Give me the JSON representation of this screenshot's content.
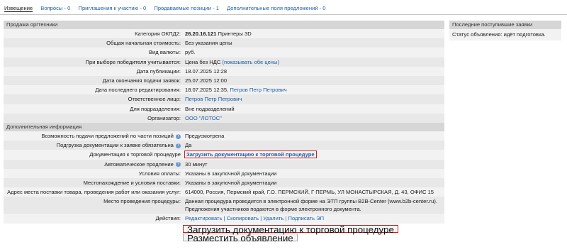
{
  "tabs": [
    {
      "label": "Извещение"
    },
    {
      "label": "Вопросы - 0"
    },
    {
      "label": "Приглашения к участию - 0"
    },
    {
      "label": "Продаваемые позиции - 1"
    },
    {
      "label": "Дополнительные поля предложений - 0"
    }
  ],
  "section1": {
    "title": "Продажа оргтехники",
    "rows": [
      {
        "label": "Категория ОКПД2:",
        "value_bold": "26.20.16.121",
        "value": " Принтеры 3D"
      },
      {
        "label": "Общая начальная стоимость:",
        "value": "Без указания цены"
      },
      {
        "label": "Вид валюты:",
        "value": "руб."
      },
      {
        "label": "При выборе победителя учитывается:",
        "value": "Цена без НДС",
        "link": "(показывать обе цены)"
      },
      {
        "label": "Дата публикации:",
        "value": "18.07.2025 12:28"
      },
      {
        "label": "Дата окончания подачи заявок:",
        "value": "25.07.2025 12:00"
      },
      {
        "label": "Дата последнего редактирования:",
        "value": "18.07.2025 12:35,",
        "link": "Петров Петр Петрович"
      },
      {
        "label": "Ответственное лицо:",
        "link": "Петров Петр Петрович"
      },
      {
        "label": "Для подразделения:",
        "value": "Вне подразделений"
      },
      {
        "label": "Организатор:",
        "link": "ООО \"ЛОТОС\""
      }
    ]
  },
  "section2": {
    "title": "Дополнительная информация",
    "rows": [
      {
        "label": "Возможность подачи предложений по части позиций",
        "value": "Предусмотрена"
      },
      {
        "label": "Подгрузка документации к заявке обязательна",
        "value": "Да"
      },
      {
        "label": "Документация к торговой процедуре",
        "link": "Загрузить документацию к торговой процедуре"
      },
      {
        "label": "Автоматическое продление",
        "value": "30 минут"
      },
      {
        "label": "Условия оплаты:",
        "value": "Указаны в закупочной документации"
      },
      {
        "label": "Местонахождение и условия поставки:",
        "value": "Указаны в закупочной документации"
      },
      {
        "label": "Адрес места поставки товара, проведения работ или оказания услуг:",
        "value": "614000, Россия, Пермский край, Г.О. ПЕРМСКИЙ, Г ПЕРМЬ, УЛ МОНАСТЫРСКАЯ, Д. 43, ОФИС 15"
      },
      {
        "label": "Место проведения процедуры:",
        "value": "Данная процедура проводится в электронной форме на ЭТП группы B2B-Center (www.b2b-center.ru).",
        "value2": "Предложения участников подаются в форме электронного документа."
      },
      {
        "label": "Действия:",
        "actions": [
          "Редактировать",
          "Скопировать",
          "Удалить",
          "Подписать ЭП"
        ]
      }
    ]
  },
  "buttons": {
    "upload": "Загрузить документацию к торговой процедуре",
    "publish": "Разместить объявление"
  },
  "sidebar": {
    "title": "Последние поступившие заявки",
    "status": "Статус объявления: идёт подготовка."
  },
  "colors": {
    "link": "#1f5fa8",
    "highlight": "#d02020",
    "header_bg": "#d6d6d6"
  }
}
